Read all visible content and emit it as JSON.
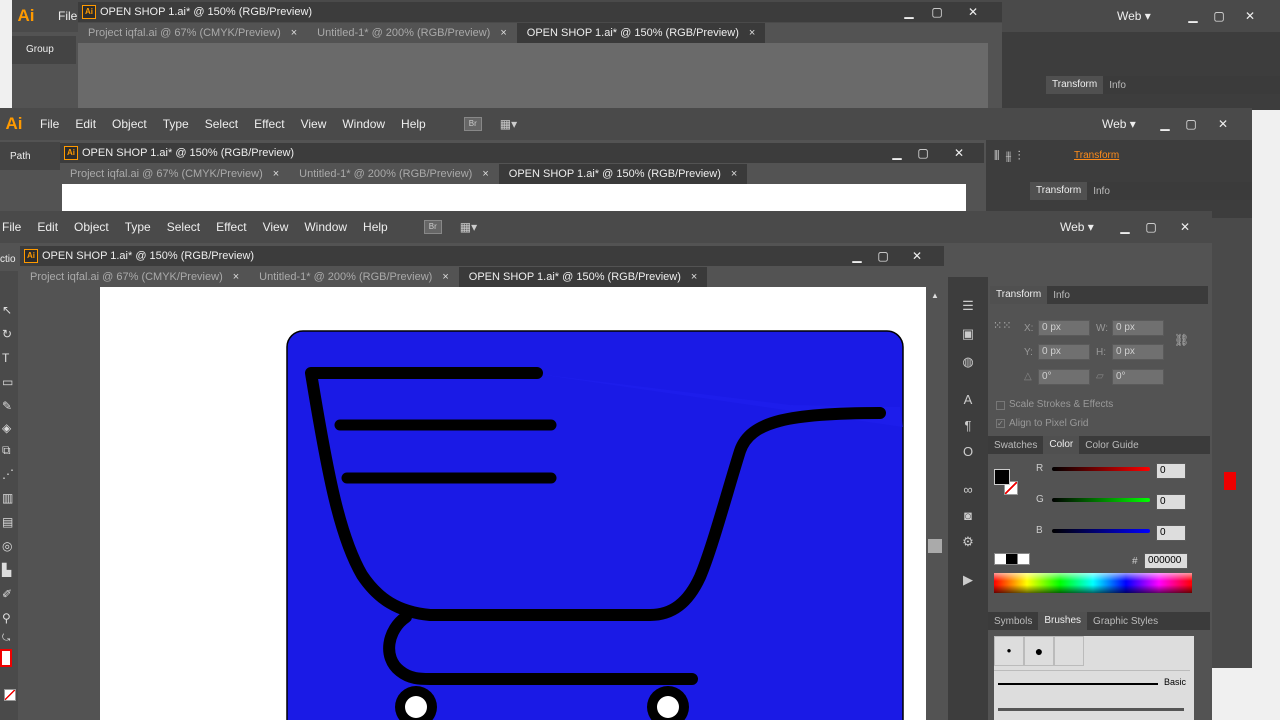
{
  "app": {
    "logo": "Ai",
    "workspace": "Web",
    "file_menu_partial": "File"
  },
  "menu": [
    "File",
    "Edit",
    "Object",
    "Type",
    "Select",
    "Effect",
    "View",
    "Window",
    "Help"
  ],
  "back": {
    "context": "Group"
  },
  "middle": {
    "context": "Path",
    "transform_link": "Transform"
  },
  "document": {
    "title": "OPEN SHOP 1.ai* @ 150% (RGB/Preview)",
    "tabs": [
      {
        "label": "Project iqfal.ai @ 67% (CMYK/Preview)"
      },
      {
        "label": "Untitled-1* @ 200% (RGB/Preview)"
      },
      {
        "label": "OPEN SHOP 1.ai* @ 150% (RGB/Preview)",
        "active": true
      }
    ]
  },
  "left_edge": {
    "partial_label": "ctio"
  },
  "transform_panel": {
    "tabs": [
      "Transform",
      "Info"
    ],
    "x_label": "X:",
    "y_label": "Y:",
    "w_label": "W:",
    "h_label": "H:",
    "x": "0 px",
    "y": "0 px",
    "w": "0 px",
    "h": "0 px",
    "angle1": "0°",
    "angle2": "0°",
    "scale_strokes": "Scale Strokes & Effects",
    "align_pixel": "Align to Pixel Grid"
  },
  "color_panel": {
    "tabs": [
      "Swatches",
      "Color",
      "Color Guide"
    ],
    "r_label": "R",
    "g_label": "G",
    "b_label": "B",
    "r": "0",
    "g": "0",
    "b": "0",
    "hex_label": "#",
    "hex": "000000"
  },
  "brushes_panel": {
    "tabs": [
      "Symbols",
      "Brushes",
      "Graphic Styles"
    ],
    "basic": "Basic"
  },
  "artwork": {
    "bg_color": "#1a1ae6",
    "stroke_color": "#000000"
  }
}
